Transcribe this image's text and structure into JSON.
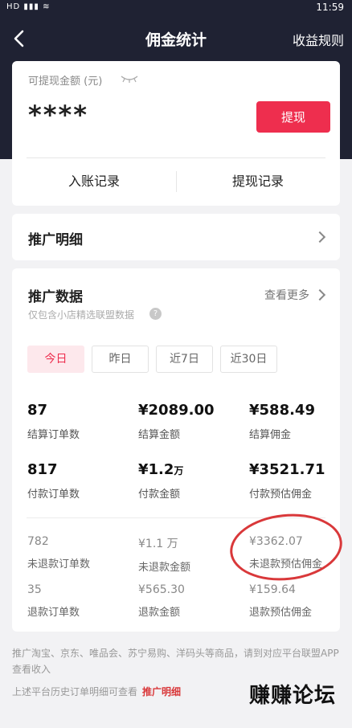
{
  "status_bar": {
    "left": "HD ▮▮▮ ≋",
    "time": "11:59"
  },
  "header": {
    "title": "佣金统计",
    "rule_link": "收益规则"
  },
  "balance": {
    "label": "可提现金额 (元)",
    "amount": "****",
    "withdraw_button": "提现",
    "tabs": [
      "入账记录",
      "提现记录"
    ]
  },
  "promo_detail": {
    "title": "推广明细"
  },
  "promo_data": {
    "title": "推广数据",
    "more": "查看更多",
    "subtitle": "仅包含小店精选联盟数据",
    "help": "?",
    "ranges": [
      "今日",
      "昨日",
      "近7日",
      "近30日"
    ],
    "active_range": "今日",
    "primary_stats": [
      {
        "value": "87",
        "label": "结算订单数"
      },
      {
        "value": "¥2089.00",
        "label": "结算金额"
      },
      {
        "value": "¥588.49",
        "label": "结算佣金"
      },
      {
        "value": "817",
        "label": "付款订单数"
      },
      {
        "value": "¥1.2",
        "unit": "万",
        "label": "付款金额"
      },
      {
        "value": "¥3521.71",
        "label": "付款预估佣金"
      }
    ],
    "secondary_stats": [
      {
        "value": "782",
        "label": "未退款订单数"
      },
      {
        "value": "¥1.1 万",
        "label": "未退款金额"
      },
      {
        "value": "¥3362.07",
        "label": "未退款预估佣金"
      },
      {
        "value": "35",
        "label": "退款订单数"
      },
      {
        "value": "¥565.30",
        "label": "退款金额"
      },
      {
        "value": "¥159.64",
        "label": "退款预估佣金"
      }
    ]
  },
  "footer": {
    "note": "推广淘宝、京东、唯品会、苏宁易购、洋码头等商品，请到对应平台联盟APP查看收入",
    "note2_prefix": "上述平台历史订单明细可查看",
    "note2_link": "推广明细"
  },
  "watermark": "赚赚论坛"
}
